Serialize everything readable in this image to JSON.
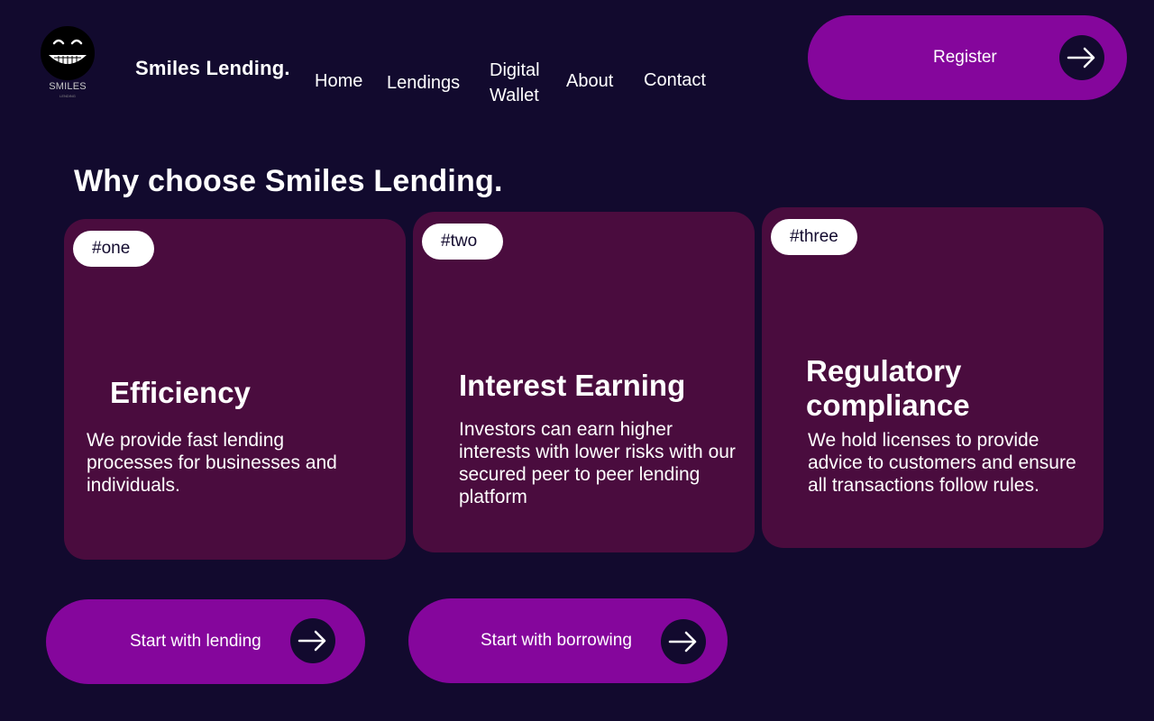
{
  "logo": {
    "text": "SMILES",
    "subtext": "LENDING"
  },
  "brand": "Smiles Lending.",
  "nav": {
    "home": "Home",
    "lendings": "Lendings",
    "wallet_line1": "Digital",
    "wallet_line2": "Wallet",
    "about": "About",
    "contact": "Contact"
  },
  "register": {
    "label": "Register"
  },
  "heading": "Why choose Smiles Lending.",
  "cards": [
    {
      "tag": "#one",
      "title": "Efficiency",
      "text": "We provide fast lending processes for businesses and individuals."
    },
    {
      "tag": "#two",
      "title": "Interest Earning",
      "text": "Investors can earn higher interests with lower risks with our secured peer to peer lending platform"
    },
    {
      "tag": "#three",
      "title": "Regulatory compliance",
      "text": "We hold licenses to provide advice to customers and ensure all transactions follow rules."
    }
  ],
  "actions": {
    "lend_label": "Start with lending",
    "borrow_label": "Start with borrowing"
  },
  "colors": {
    "background": "#120a2e",
    "accent": "#85069c",
    "card": "#4a0c3e",
    "tag_background": "#ffffff"
  },
  "icons": {
    "logo": "grinning-face-icon",
    "arrow": "arrow-right-icon"
  }
}
